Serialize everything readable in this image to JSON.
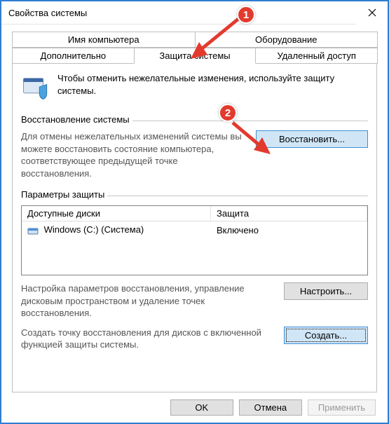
{
  "window": {
    "title": "Свойства системы"
  },
  "badges": {
    "b1": "1",
    "b2": "2"
  },
  "tabs": {
    "row1": {
      "t0": "Имя компьютера",
      "t1": "Оборудование"
    },
    "row2": {
      "t0": "Дополнительно",
      "t1": "Защита системы",
      "t2": "Удаленный доступ"
    }
  },
  "intro": {
    "text": "Чтобы отменить нежелательные изменения, используйте защиту системы."
  },
  "restore": {
    "group_title": "Восстановление системы",
    "text": "Для отмены нежелательных изменений системы вы можете восстановить состояние компьютера, соответствующее предыдущей точке восстановления.",
    "button": "Восстановить..."
  },
  "settings": {
    "group_title": "Параметры защиты",
    "col_drives": "Доступные диски",
    "col_protection": "Защита",
    "row0_drive": "Windows (C:) (Система)",
    "row0_protection": "Включено",
    "configure_text": "Настройка параметров восстановления, управление дисковым пространством и удаление точек восстановления.",
    "configure_button": "Настроить...",
    "create_text": "Создать точку восстановления для дисков с включенной функцией защиты системы.",
    "create_button": "Создать..."
  },
  "dialog": {
    "ok": "OK",
    "cancel": "Отмена",
    "apply": "Применить"
  }
}
